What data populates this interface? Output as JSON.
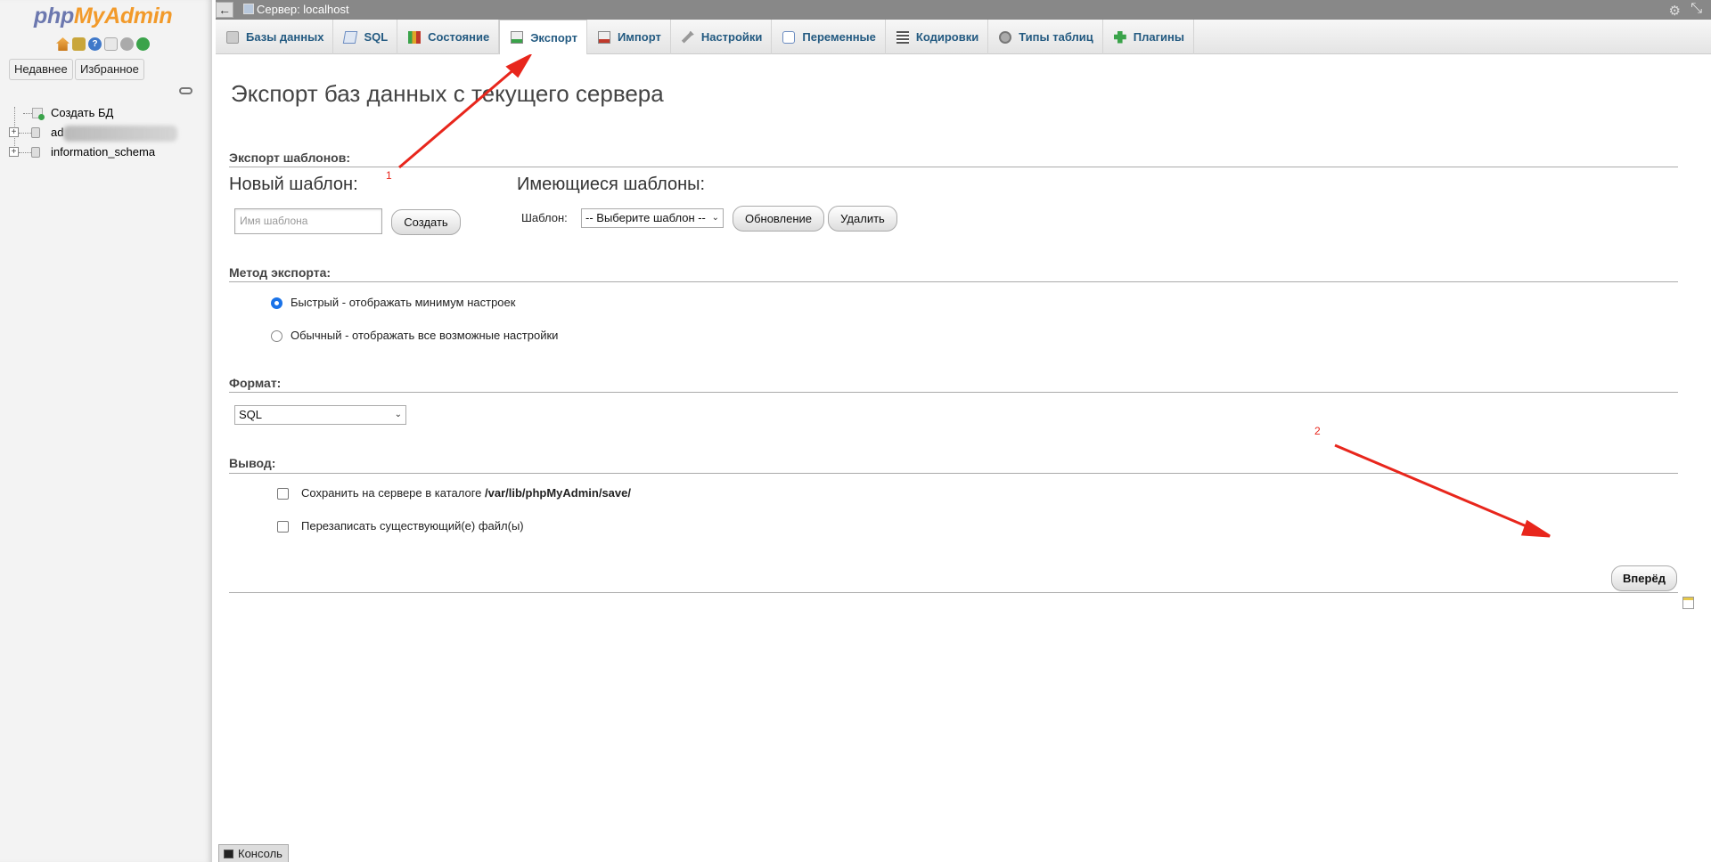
{
  "sidebar": {
    "logo": {
      "php": "php",
      "my": "My",
      "admin": "Admin"
    },
    "icons": [
      "home-icon",
      "exit-icon",
      "help-icon",
      "docs-icon",
      "settings-icon",
      "reload-icon"
    ],
    "recent_label": "Недавнее",
    "favorites_label": "Избранное",
    "tree": [
      {
        "label": "Создать БД",
        "type": "new"
      },
      {
        "label": "ad",
        "type": "db",
        "blurred": true
      },
      {
        "label": "information_schema",
        "type": "db"
      }
    ]
  },
  "topbar": {
    "title": "Сервер: localhost"
  },
  "tabs": [
    {
      "label": "Базы данных",
      "icon": "database-icon"
    },
    {
      "label": "SQL",
      "icon": "sql-icon"
    },
    {
      "label": "Состояние",
      "icon": "status-icon"
    },
    {
      "label": "Экспорт",
      "icon": "export-icon",
      "active": true
    },
    {
      "label": "Импорт",
      "icon": "import-icon"
    },
    {
      "label": "Настройки",
      "icon": "settings-icon"
    },
    {
      "label": "Переменные",
      "icon": "variables-icon"
    },
    {
      "label": "Кодировки",
      "icon": "charset-icon"
    },
    {
      "label": "Типы таблиц",
      "icon": "engines-icon"
    },
    {
      "label": "Плагины",
      "icon": "plugins-icon"
    }
  ],
  "page": {
    "title": "Экспорт баз данных с текущего сервера",
    "templates": {
      "section": "Экспорт шаблонов:",
      "new_heading": "Новый шаблон:",
      "name_placeholder": "Имя шаблона",
      "create_button": "Создать",
      "existing_heading": "Имеющиеся шаблоны:",
      "template_label": "Шаблон:",
      "template_select": "-- Выберите шаблон --",
      "update_button": "Обновление",
      "delete_button": "Удалить"
    },
    "method": {
      "section": "Метод экспорта:",
      "quick": "Быстрый - отображать минимум настроек",
      "custom": "Обычный - отображать все возможные настройки",
      "selected": "quick"
    },
    "format": {
      "section": "Формат:",
      "value": "SQL"
    },
    "output": {
      "section": "Вывод:",
      "save_prefix": "Сохранить на сервере в каталоге ",
      "save_path": "/var/lib/phpMyAdmin/save/",
      "overwrite": "Перезаписать существующий(е) файл(ы)"
    },
    "go_button": "Вперёд"
  },
  "annotations": {
    "marker1": "1",
    "marker2": "2",
    "color": "#e8261c"
  },
  "console": {
    "label": "Консоль"
  }
}
